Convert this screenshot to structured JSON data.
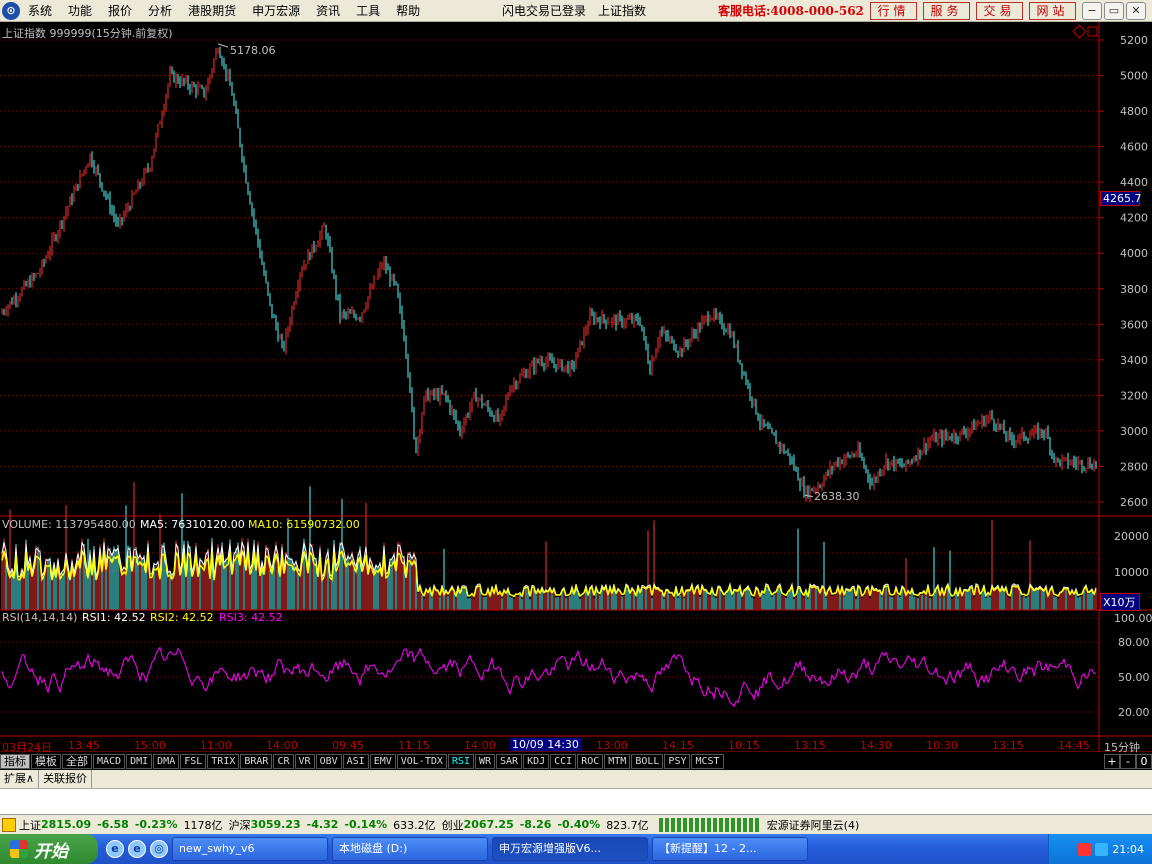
{
  "menubar": {
    "logo": "⊙",
    "items": [
      "系统",
      "功能",
      "报价",
      "分析",
      "港股期货",
      "申万宏源",
      "资讯",
      "工具",
      "帮助"
    ],
    "status_login": "闪电交易已登录",
    "status_index": "上证指数",
    "hotline": "客服电话:4008-000-562",
    "quick_buttons": [
      "行情",
      "服务",
      "交易",
      "网站"
    ],
    "window_buttons": [
      "−",
      "▭",
      "✕"
    ]
  },
  "main_chart": {
    "title": "上证指数 999999(15分钟.前复权)",
    "max_label": "5178.06",
    "min_label": "2638.30",
    "current_price": "4265.7",
    "y_ticks": [
      "5200",
      "5000",
      "4800",
      "4600",
      "4400",
      "4200",
      "4000",
      "3800",
      "3600",
      "3400",
      "3200",
      "3000",
      "2800",
      "2600"
    ]
  },
  "volume_panel": {
    "label": "VOLUME: 113795480.00",
    "ma5": "MA5: 76310120.00",
    "ma10": "MA10: 61590732.00",
    "y_ticks": [
      "20000",
      "10000"
    ],
    "unit": "X10万"
  },
  "rsi_panel": {
    "label": "RSI(14,14,14)",
    "rsi1": "RSI1: 42.52",
    "rsi2": "RSI2: 42.52",
    "rsi3": "RSI3: 42.52",
    "y_ticks": [
      "100.00",
      "80.00",
      "50.00",
      "20.00"
    ]
  },
  "time_axis": {
    "labels": [
      "03月24日",
      "13:45",
      "15:00",
      "11:00",
      "14:00",
      "09:45",
      "11:15",
      "14:00",
      "10/09 14:30",
      "13:00",
      "14:15",
      "10:15",
      "13:15",
      "14:30",
      "10:30",
      "13:15",
      "14:45"
    ],
    "period": "15分钟"
  },
  "indicator_bar": {
    "tabs": [
      "指标",
      "模板",
      "全部",
      "MACD",
      "DMI",
      "DMA",
      "FSL",
      "TRIX",
      "BRAR",
      "CR",
      "VR",
      "OBV",
      "ASI",
      "EMV",
      "VOL-TDX",
      "RSI",
      "WR",
      "SAR",
      "KDJ",
      "CCI",
      "ROC",
      "MTM",
      "BOLL",
      "PSY",
      "MCST"
    ],
    "active": "RSI",
    "controls": [
      "+",
      "-",
      "0"
    ]
  },
  "ext_row": {
    "tabs": [
      "扩展∧",
      "关联报价"
    ]
  },
  "statusbar": {
    "sh_name": "上证",
    "sh_price": "2815.09",
    "sh_change": "-6.58",
    "sh_pct": "-0.23%",
    "sh_amount": "1178亿",
    "hs_name": "沪深",
    "hs_price": "3059.23",
    "hs_change": "-4.32",
    "hs_pct": "-0.14%",
    "hs_amount": "633.2亿",
    "cy_name": "创业",
    "cy_price": "2067.25",
    "cy_change": "-8.26",
    "cy_pct": "-0.40%",
    "cy_amount": "823.7亿",
    "broker": "宏源证券阿里云(4)"
  },
  "taskbar": {
    "start": "开始",
    "quicklaunch": [
      "e",
      "e",
      "◎"
    ],
    "windows": [
      "new_swhy_v6",
      "本地磁盘 (D:)",
      "申万宏源增强版V6...",
      "【新提醒】12 - 2..."
    ],
    "clock": "21:04"
  },
  "colors": {
    "up": "#ff3232",
    "down": "#54fcfc",
    "grid": "#800000",
    "axis": "#c00000",
    "rsi": "#ff00ff",
    "ma5": "#ffffff",
    "ma10": "#ffff00"
  }
}
